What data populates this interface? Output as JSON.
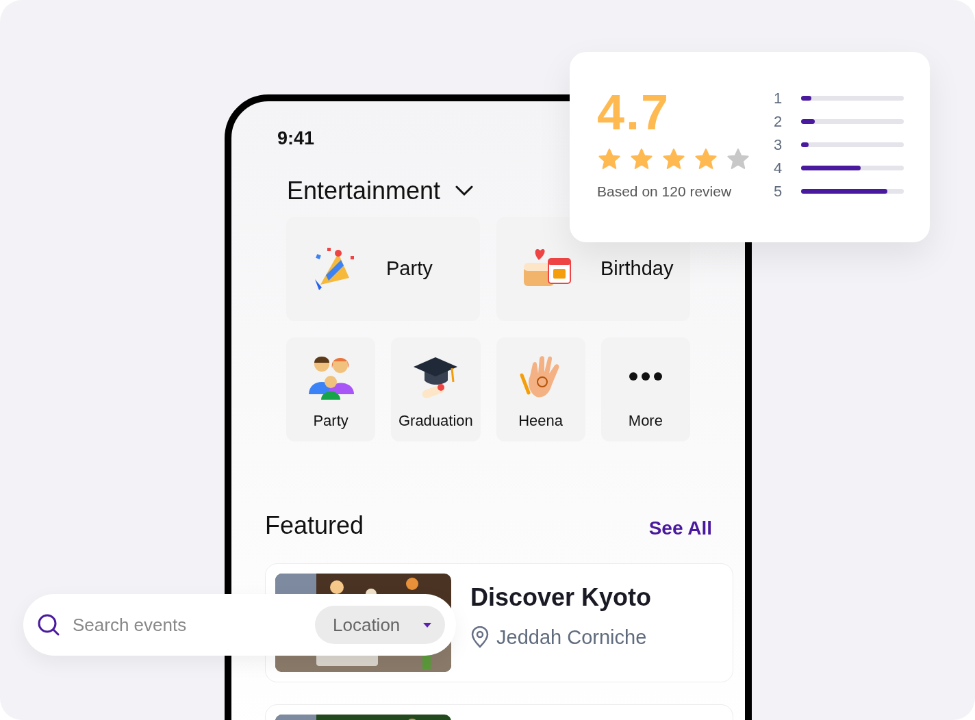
{
  "status_bar": {
    "time": "9:41"
  },
  "category_menu": {
    "label": "Entertainment"
  },
  "featured_categories": [
    {
      "label": "Party"
    },
    {
      "label": "Birthday"
    }
  ],
  "categories": [
    {
      "label": "Party"
    },
    {
      "label": "Graduation"
    },
    {
      "label": "Heena"
    },
    {
      "label": "More"
    }
  ],
  "featured": {
    "title": "Featured",
    "see_all": "See All",
    "events": [
      {
        "title": "Discover Kyoto",
        "location": "Jeddah Corniche"
      }
    ]
  },
  "rating": {
    "score": "4.7",
    "stars": 4,
    "caption": "Based on 120 review",
    "breakdown": [
      {
        "label": "1",
        "level": 0.1
      },
      {
        "label": "2",
        "level": 0.13
      },
      {
        "label": "3",
        "level": 0.07
      },
      {
        "label": "4",
        "level": 0.58
      },
      {
        "label": "5",
        "level": 0.84
      }
    ]
  },
  "search": {
    "placeholder": "Search events",
    "location_filter": "Location"
  }
}
